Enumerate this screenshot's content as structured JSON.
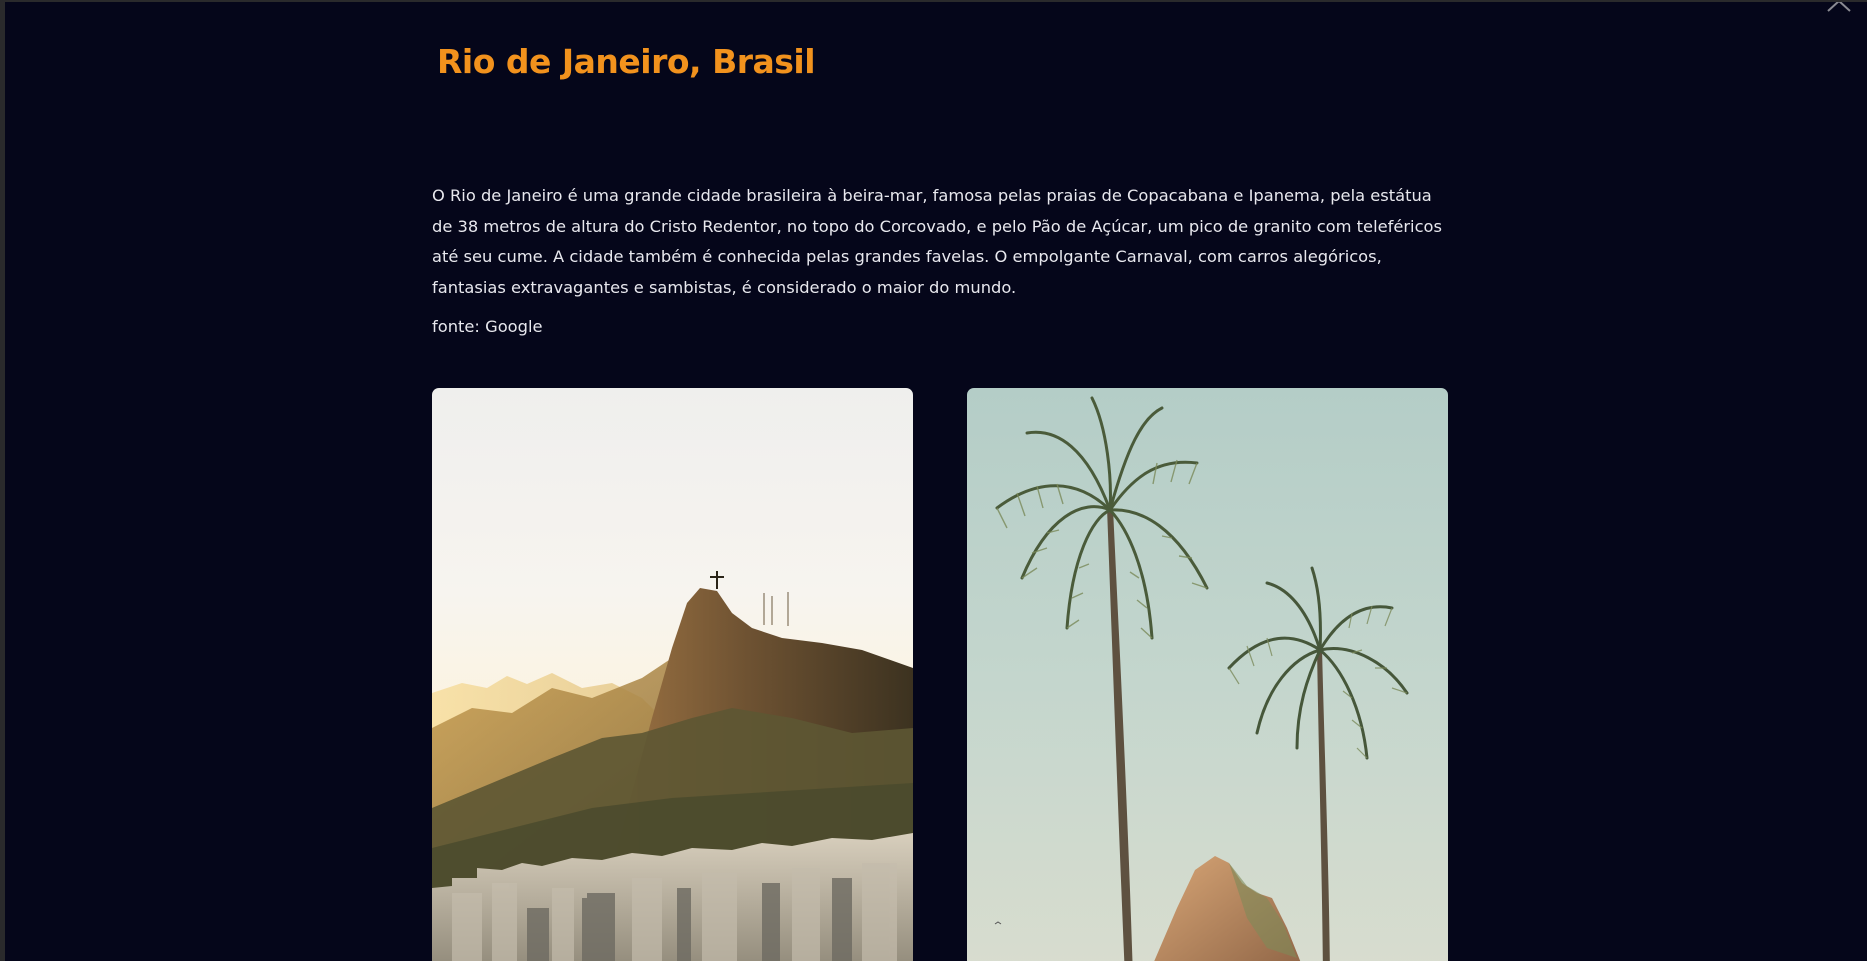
{
  "modal": {
    "title": "Rio de Janeiro, Brasil",
    "description": "O Rio de Janeiro é uma grande cidade brasileira à beira-mar, famosa pelas praias de Copacabana e Ipanema, pela estátua de 38 metros de altura do Cristo Redentor, no topo do Corcovado, e pelo Pão de Açúcar, um pico de granito com teleféricos até seu cume. A cidade também é conhecida pelas grandes favelas. O empolgante Carnaval, com carros alegóricos, fantasias extravagantes e sambistas, é considerado o maior do mundo.",
    "source": "fonte: Google",
    "close_icon": "chevron-up-icon"
  },
  "colors": {
    "background": "#05061a",
    "title": "#f2921d",
    "text": "#e8e8ee"
  },
  "images": [
    {
      "subject": "corcovado-cristo-redentor-sunset"
    },
    {
      "subject": "palm-trees-dois-irmaos"
    }
  ]
}
